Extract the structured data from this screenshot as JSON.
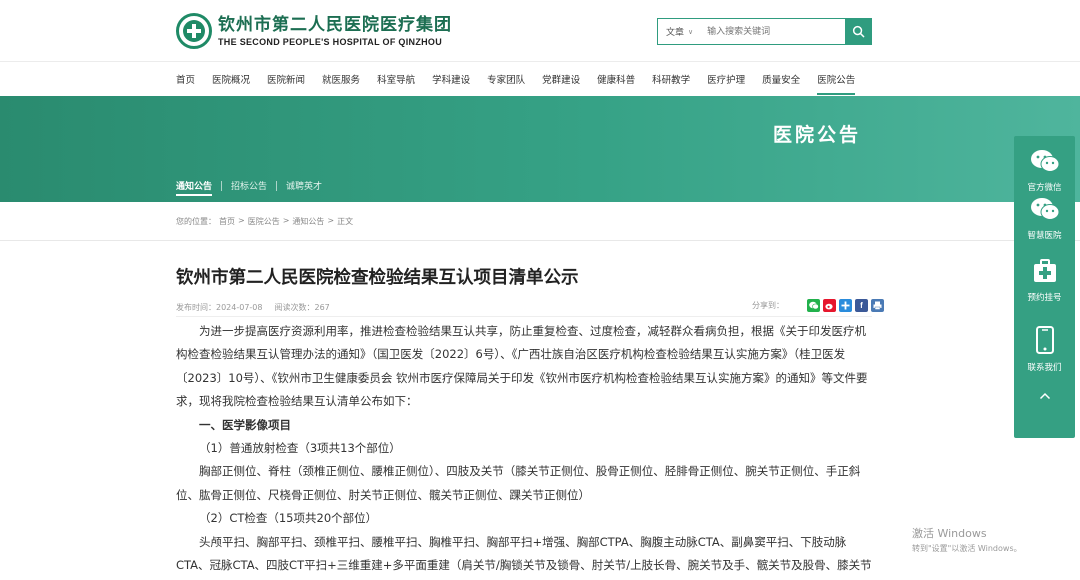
{
  "header": {
    "logo_cn": "钦州市第二人民医院医疗集团",
    "logo_en": "THE SECOND PEOPLE'S HOSPITAL OF QINZHOU"
  },
  "search": {
    "type_label": "文章",
    "placeholder": "输入搜索关键词"
  },
  "nav": {
    "items": [
      {
        "label": "首页"
      },
      {
        "label": "医院概况"
      },
      {
        "label": "医院新闻"
      },
      {
        "label": "就医服务"
      },
      {
        "label": "科室导航"
      },
      {
        "label": "学科建设"
      },
      {
        "label": "专家团队"
      },
      {
        "label": "党群建设"
      },
      {
        "label": "健康科普"
      },
      {
        "label": "科研教学"
      },
      {
        "label": "医疗护理"
      },
      {
        "label": "质量安全"
      },
      {
        "label": "医院公告"
      }
    ],
    "active_index": 12
  },
  "banner": {
    "title": "医院公告",
    "tabs": [
      {
        "label": "通知公告",
        "active": true
      },
      {
        "label": "招标公告",
        "active": false
      },
      {
        "label": "诚聘英才",
        "active": false
      }
    ]
  },
  "breadcrumb": {
    "prefix": "您的位置：",
    "items": [
      "首页",
      "医院公告",
      "通知公告",
      "正文"
    ],
    "separator": ">"
  },
  "article": {
    "title": "钦州市第二人民医院检查检验结果互认项目清单公示",
    "publish_time": "发布时间：2024-07-08",
    "views": "阅读次数：267",
    "share_label": "分享到：",
    "paragraphs": {
      "intro": "为进一步提高医疗资源利用率，推进检查检验结果互认共享，防止重复检查、过度检查，减轻群众看病负担，根据《关于印发医疗机构检查检验结果互认管理办法的通知》（国卫医发〔2022〕6号）、《广西壮族自治区医疗机构检查检验结果互认实施方案》（桂卫医发〔2023〕10号）、《钦州市卫生健康委员会 钦州市医疗保障局关于印发《钦州市医疗机构检查检验结果互认实施方案》的通知》等文件要求，现将我院检查检验结果互认清单公布如下：",
      "section1": "一、医学影像项目",
      "sub1": "（1）普通放射检查（3项共13个部位）",
      "sub1_body": "胸部正侧位、脊柱（颈椎正侧位、腰椎正侧位）、四肢及关节（膝关节正侧位、股骨正侧位、胫腓骨正侧位、腕关节正侧位、手正斜位、肱骨正侧位、尺桡骨正侧位、肘关节正侧位、髋关节正侧位、踝关节正侧位）",
      "sub2": "（2）CT检查（15项共20个部位）",
      "sub2_body": "头颅平扫、胸部平扫、颈椎平扫、腰椎平扫、胸椎平扫、胸部平扫+增强、胸部CTPA、胸腹主动脉CTA、副鼻窦平扫、下肢动脉CTA、冠脉CTA、四肢CT平扫+三维重建+多平面重建（肩关节/胸锁关节及锁骨、肘关节/上肢长骨、腕关节及手、髋关节及股骨、膝关节及胫腓骨、踝关节及足）、上腹部及腹膀胱CTV、上腹部平扫+动态增强、中腹部平扫+增强"
    }
  },
  "float_panel": {
    "items": [
      {
        "label": "官方微信",
        "icon": "wechat-icon"
      },
      {
        "label": "智慧医院",
        "icon": "wechat-icon"
      },
      {
        "label": "预约挂号",
        "icon": "medical-kit-icon"
      },
      {
        "label": "联系我们",
        "icon": "phone-icon"
      }
    ],
    "up_icon": "chevron-up-icon"
  },
  "watermark": {
    "line1": "激活 Windows",
    "line2": "转到\"设置\"以激活 Windows。"
  },
  "colors": {
    "brand": "#2f9c7f",
    "banner_start": "#2a8b6f",
    "banner_end": "#4fb59d",
    "wechat": "#22b14c",
    "weibo": "#e6162d",
    "facebook": "#3b5998",
    "plus": "#2a8cdc"
  }
}
